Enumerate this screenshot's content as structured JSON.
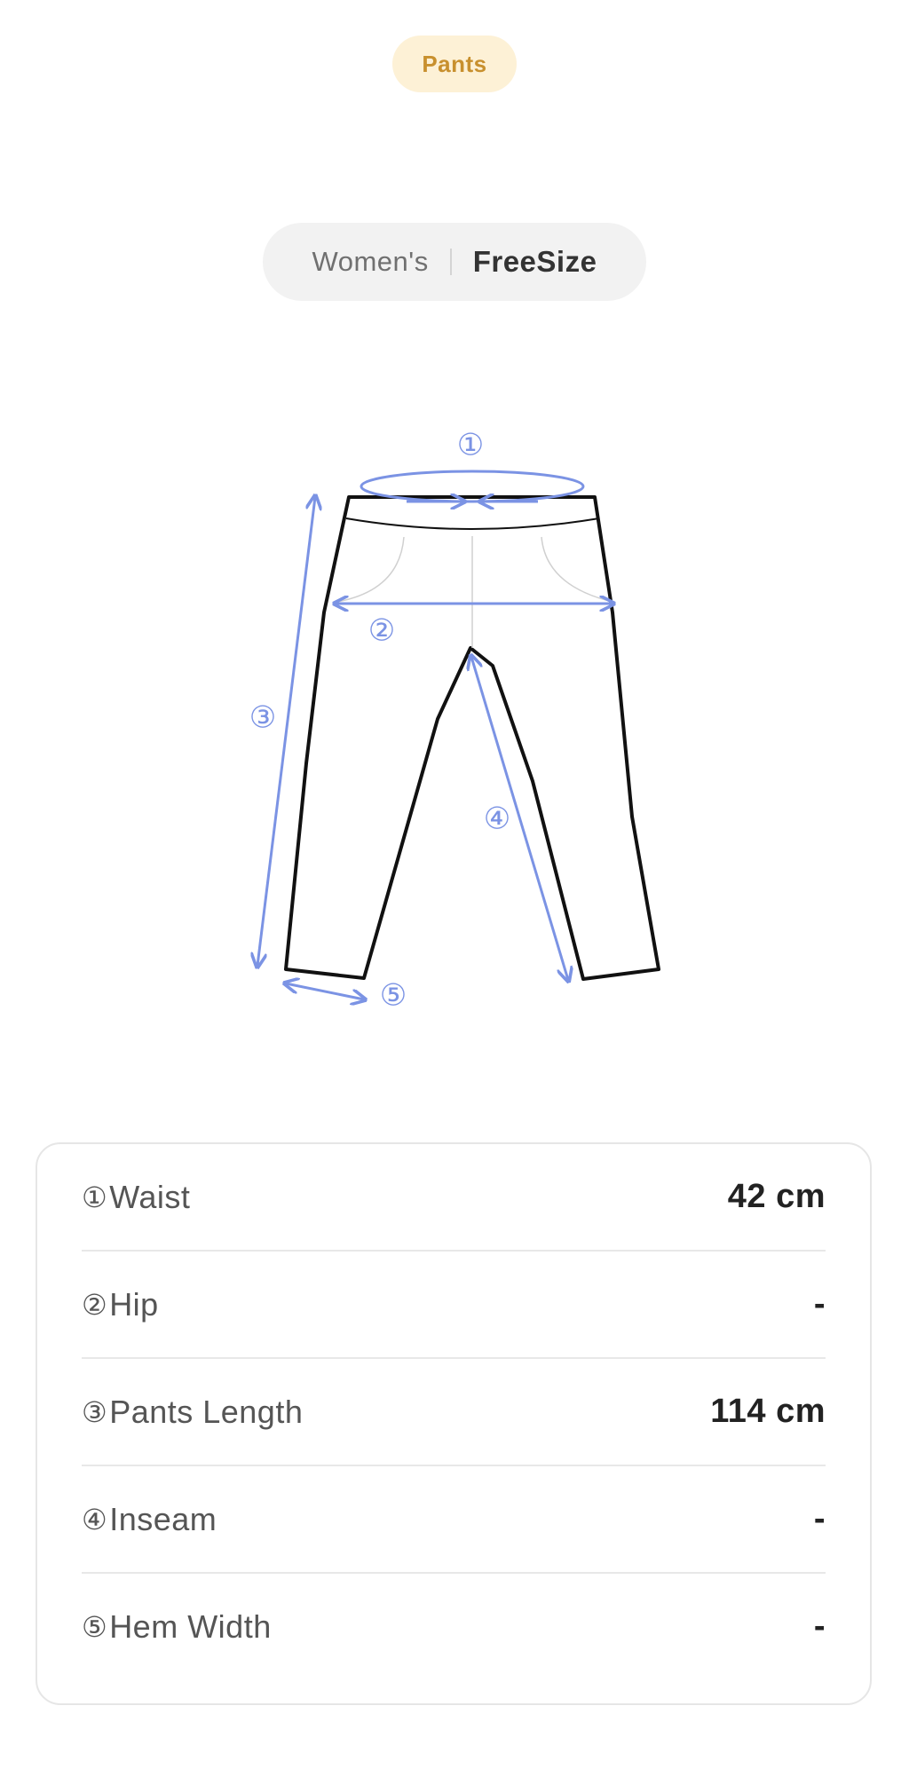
{
  "category": {
    "label": "Pants"
  },
  "size_selector": {
    "gender": "Women's",
    "size": "FreeSize"
  },
  "diagram": {
    "markers": [
      "①",
      "②",
      "③",
      "④",
      "⑤"
    ],
    "accent_color": "#7b93e4",
    "outline_color": "#111111"
  },
  "measurements": [
    {
      "num": "①",
      "label": "Waist",
      "value": "42 cm"
    },
    {
      "num": "②",
      "label": "Hip",
      "value": "-"
    },
    {
      "num": "③",
      "label": "Pants Length",
      "value": "114 cm"
    },
    {
      "num": "④",
      "label": "Inseam",
      "value": "-"
    },
    {
      "num": "⑤",
      "label": "Hem Width",
      "value": "-"
    }
  ]
}
